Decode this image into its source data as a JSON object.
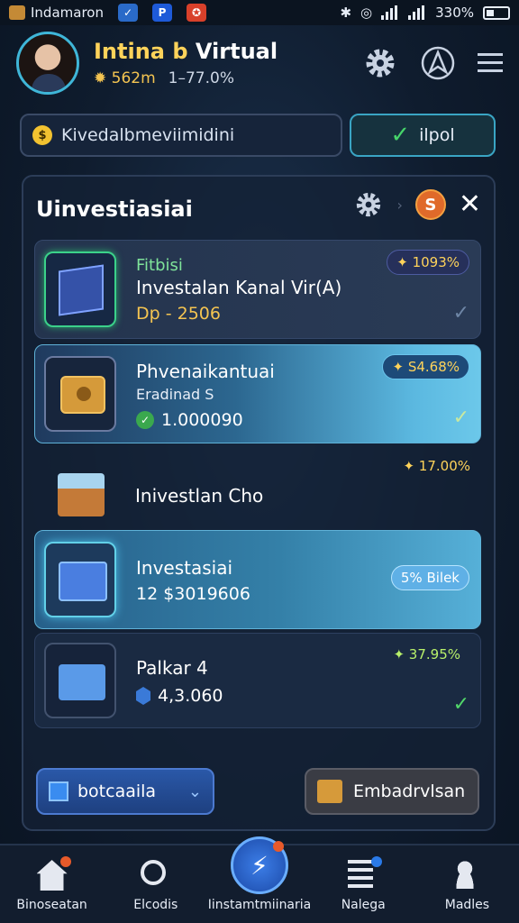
{
  "status_bar": {
    "app_label": "Indamaron",
    "badge_1": "✓",
    "badge_2": "P",
    "badge_3": "✪",
    "battery_text": "330%"
  },
  "header": {
    "name_prefix": "Intina b",
    "name_suffix": "Virtual",
    "coins": "562m",
    "change": "1–77.0%"
  },
  "search": {
    "placeholder": "Kivedalbmeviimidini",
    "ok_label": "ilpol"
  },
  "panel": {
    "title": "Uinvestiasiai",
    "coin_letter": "S",
    "close": "✕"
  },
  "cards": [
    {
      "tag": "Fitbisi",
      "name": "Investalan Kanal Vir(A)",
      "sub": "Dp - 2506",
      "badge": "✦ 1093%"
    },
    {
      "name": "Phvenaikantuai",
      "sub": "Eradinad S",
      "value": "1.000090",
      "badge": "✦ S4.68%"
    },
    {
      "name": "Inivestlan Cho",
      "badge": "✦ 17.00%"
    },
    {
      "name": "Investasiai",
      "value": "12 $3019606",
      "badge": "5% Bilek"
    },
    {
      "name": "Palkar 4",
      "value": "4,3.060",
      "badge": "✦ 37.95%"
    }
  ],
  "buttons": {
    "left": "botcaaila",
    "right": "Embadrvlsan"
  },
  "nav": [
    {
      "label": "Binoseatan"
    },
    {
      "label": "Elcodis"
    },
    {
      "label": "Iinstamtmiinaria"
    },
    {
      "label": "Nalega"
    },
    {
      "label": "Madles"
    }
  ],
  "colors": {
    "accent_gold": "#ffd35a",
    "accent_cyan": "#3fb6d8",
    "success_green": "#52d86a",
    "background": "#0f1c2e"
  }
}
